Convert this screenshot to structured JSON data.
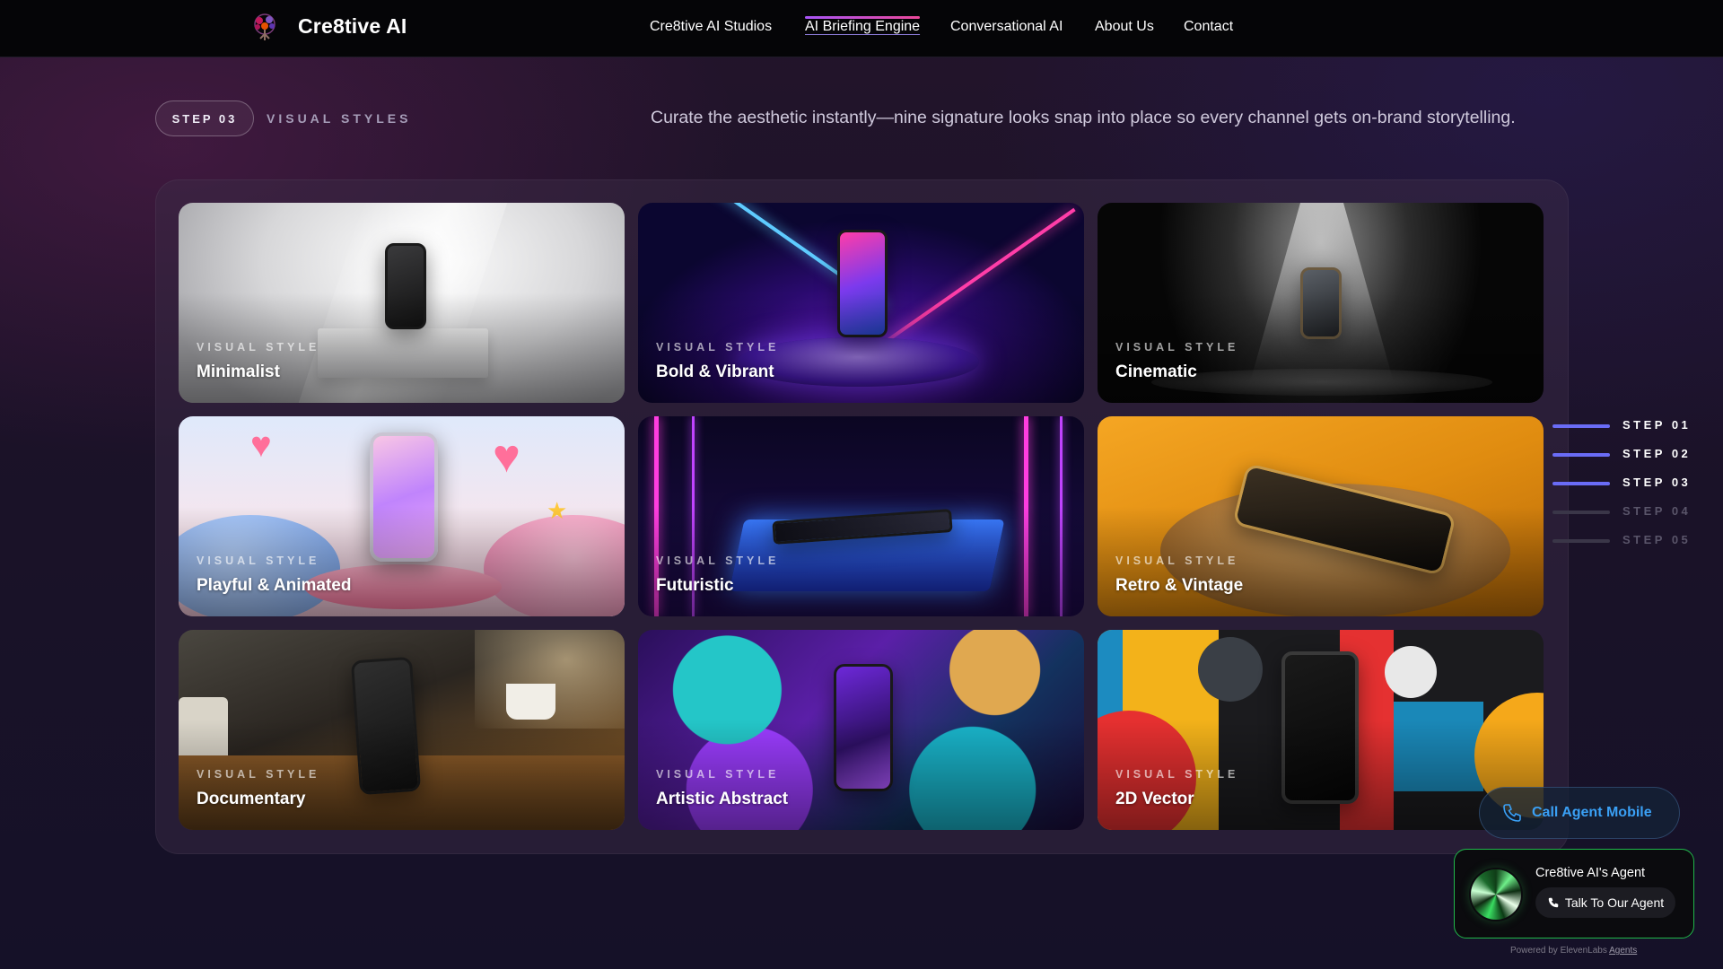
{
  "nav": {
    "brand": "Cre8tive AI",
    "links": [
      {
        "label": "Cre8tive AI Studios"
      },
      {
        "label": "AI Briefing Engine"
      },
      {
        "label": "Conversational AI"
      },
      {
        "label": "About Us"
      },
      {
        "label": "Contact"
      }
    ],
    "active_index": 1
  },
  "step_header": {
    "badge": "STEP 03",
    "label": "VISUAL STYLES",
    "tagline": "Curate the aesthetic instantly—nine signature looks snap into place so every channel gets on-brand storytelling."
  },
  "styles": [
    {
      "kicker": "VISUAL STYLE",
      "title": "Minimalist"
    },
    {
      "kicker": "VISUAL STYLE",
      "title": "Bold & Vibrant"
    },
    {
      "kicker": "VISUAL STYLE",
      "title": "Cinematic"
    },
    {
      "kicker": "VISUAL STYLE",
      "title": "Playful & Animated"
    },
    {
      "kicker": "VISUAL STYLE",
      "title": "Futuristic"
    },
    {
      "kicker": "VISUAL STYLE",
      "title": "Retro & Vintage"
    },
    {
      "kicker": "VISUAL STYLE",
      "title": "Documentary"
    },
    {
      "kicker": "VISUAL STYLE",
      "title": "Artistic Abstract"
    },
    {
      "kicker": "VISUAL STYLE",
      "title": "2D Vector"
    }
  ],
  "tracker": {
    "steps": [
      "STEP 01",
      "STEP 02",
      "STEP 03",
      "STEP 04",
      "STEP 05"
    ],
    "current": 3,
    "active_color": "#6a6cf6",
    "inactive_color": "#3a3648"
  },
  "call_button": {
    "label": "Call Agent Mobile",
    "icon": "phone-icon"
  },
  "agent_widget": {
    "name": "Cre8tive AI's Agent",
    "button": "Talk To Our Agent",
    "powered_prefix": "Powered by ElevenLabs",
    "powered_link": "Agents"
  },
  "colors": {
    "accent": "#a855f7",
    "call_blue": "#3aa0f5",
    "agent_green": "#20b84a"
  }
}
